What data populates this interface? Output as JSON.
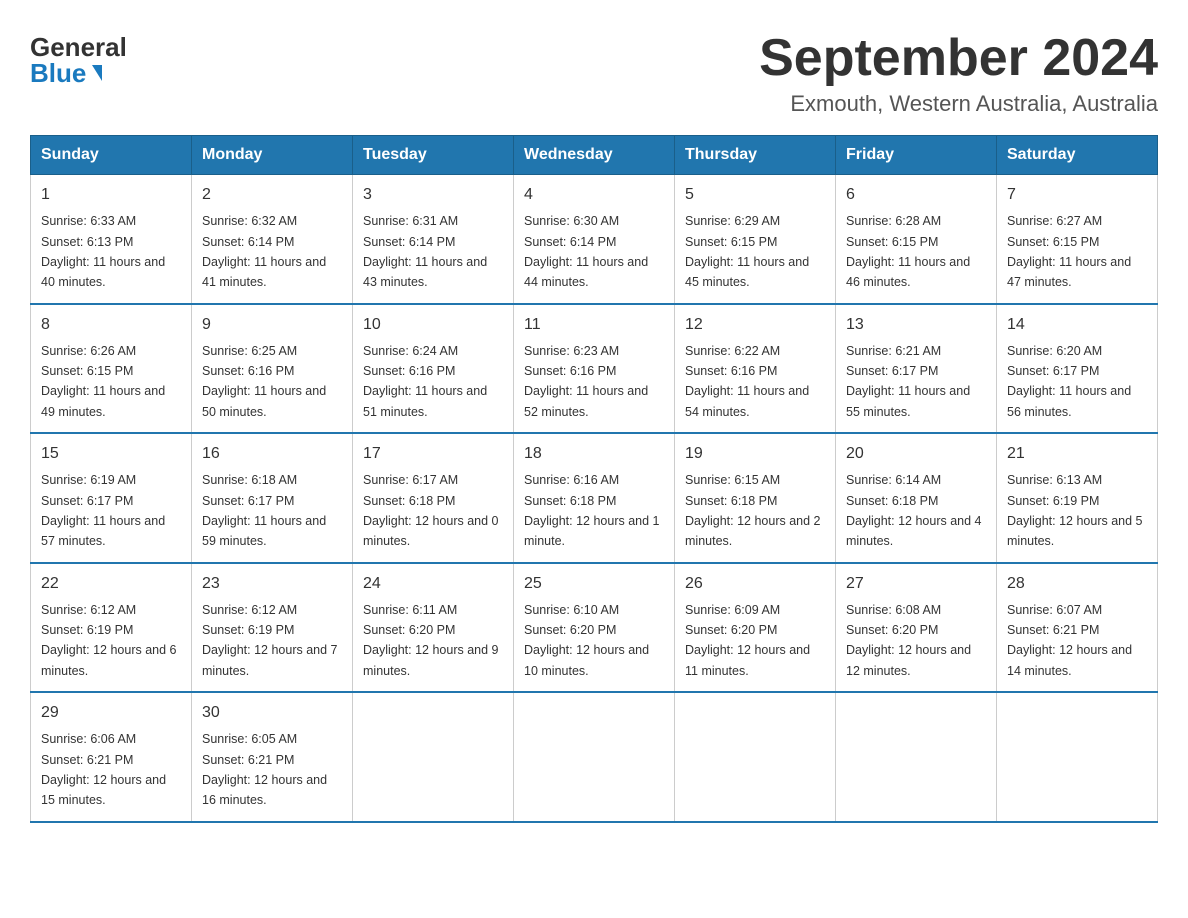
{
  "logo": {
    "general": "General",
    "blue": "Blue"
  },
  "header": {
    "title": "September 2024",
    "location": "Exmouth, Western Australia, Australia"
  },
  "days_of_week": [
    "Sunday",
    "Monday",
    "Tuesday",
    "Wednesday",
    "Thursday",
    "Friday",
    "Saturday"
  ],
  "weeks": [
    [
      {
        "day": "1",
        "sunrise": "6:33 AM",
        "sunset": "6:13 PM",
        "daylight": "11 hours and 40 minutes."
      },
      {
        "day": "2",
        "sunrise": "6:32 AM",
        "sunset": "6:14 PM",
        "daylight": "11 hours and 41 minutes."
      },
      {
        "day": "3",
        "sunrise": "6:31 AM",
        "sunset": "6:14 PM",
        "daylight": "11 hours and 43 minutes."
      },
      {
        "day": "4",
        "sunrise": "6:30 AM",
        "sunset": "6:14 PM",
        "daylight": "11 hours and 44 minutes."
      },
      {
        "day": "5",
        "sunrise": "6:29 AM",
        "sunset": "6:15 PM",
        "daylight": "11 hours and 45 minutes."
      },
      {
        "day": "6",
        "sunrise": "6:28 AM",
        "sunset": "6:15 PM",
        "daylight": "11 hours and 46 minutes."
      },
      {
        "day": "7",
        "sunrise": "6:27 AM",
        "sunset": "6:15 PM",
        "daylight": "11 hours and 47 minutes."
      }
    ],
    [
      {
        "day": "8",
        "sunrise": "6:26 AM",
        "sunset": "6:15 PM",
        "daylight": "11 hours and 49 minutes."
      },
      {
        "day": "9",
        "sunrise": "6:25 AM",
        "sunset": "6:16 PM",
        "daylight": "11 hours and 50 minutes."
      },
      {
        "day": "10",
        "sunrise": "6:24 AM",
        "sunset": "6:16 PM",
        "daylight": "11 hours and 51 minutes."
      },
      {
        "day": "11",
        "sunrise": "6:23 AM",
        "sunset": "6:16 PM",
        "daylight": "11 hours and 52 minutes."
      },
      {
        "day": "12",
        "sunrise": "6:22 AM",
        "sunset": "6:16 PM",
        "daylight": "11 hours and 54 minutes."
      },
      {
        "day": "13",
        "sunrise": "6:21 AM",
        "sunset": "6:17 PM",
        "daylight": "11 hours and 55 minutes."
      },
      {
        "day": "14",
        "sunrise": "6:20 AM",
        "sunset": "6:17 PM",
        "daylight": "11 hours and 56 minutes."
      }
    ],
    [
      {
        "day": "15",
        "sunrise": "6:19 AM",
        "sunset": "6:17 PM",
        "daylight": "11 hours and 57 minutes."
      },
      {
        "day": "16",
        "sunrise": "6:18 AM",
        "sunset": "6:17 PM",
        "daylight": "11 hours and 59 minutes."
      },
      {
        "day": "17",
        "sunrise": "6:17 AM",
        "sunset": "6:18 PM",
        "daylight": "12 hours and 0 minutes."
      },
      {
        "day": "18",
        "sunrise": "6:16 AM",
        "sunset": "6:18 PM",
        "daylight": "12 hours and 1 minute."
      },
      {
        "day": "19",
        "sunrise": "6:15 AM",
        "sunset": "6:18 PM",
        "daylight": "12 hours and 2 minutes."
      },
      {
        "day": "20",
        "sunrise": "6:14 AM",
        "sunset": "6:18 PM",
        "daylight": "12 hours and 4 minutes."
      },
      {
        "day": "21",
        "sunrise": "6:13 AM",
        "sunset": "6:19 PM",
        "daylight": "12 hours and 5 minutes."
      }
    ],
    [
      {
        "day": "22",
        "sunrise": "6:12 AM",
        "sunset": "6:19 PM",
        "daylight": "12 hours and 6 minutes."
      },
      {
        "day": "23",
        "sunrise": "6:12 AM",
        "sunset": "6:19 PM",
        "daylight": "12 hours and 7 minutes."
      },
      {
        "day": "24",
        "sunrise": "6:11 AM",
        "sunset": "6:20 PM",
        "daylight": "12 hours and 9 minutes."
      },
      {
        "day": "25",
        "sunrise": "6:10 AM",
        "sunset": "6:20 PM",
        "daylight": "12 hours and 10 minutes."
      },
      {
        "day": "26",
        "sunrise": "6:09 AM",
        "sunset": "6:20 PM",
        "daylight": "12 hours and 11 minutes."
      },
      {
        "day": "27",
        "sunrise": "6:08 AM",
        "sunset": "6:20 PM",
        "daylight": "12 hours and 12 minutes."
      },
      {
        "day": "28",
        "sunrise": "6:07 AM",
        "sunset": "6:21 PM",
        "daylight": "12 hours and 14 minutes."
      }
    ],
    [
      {
        "day": "29",
        "sunrise": "6:06 AM",
        "sunset": "6:21 PM",
        "daylight": "12 hours and 15 minutes."
      },
      {
        "day": "30",
        "sunrise": "6:05 AM",
        "sunset": "6:21 PM",
        "daylight": "12 hours and 16 minutes."
      },
      null,
      null,
      null,
      null,
      null
    ]
  ]
}
